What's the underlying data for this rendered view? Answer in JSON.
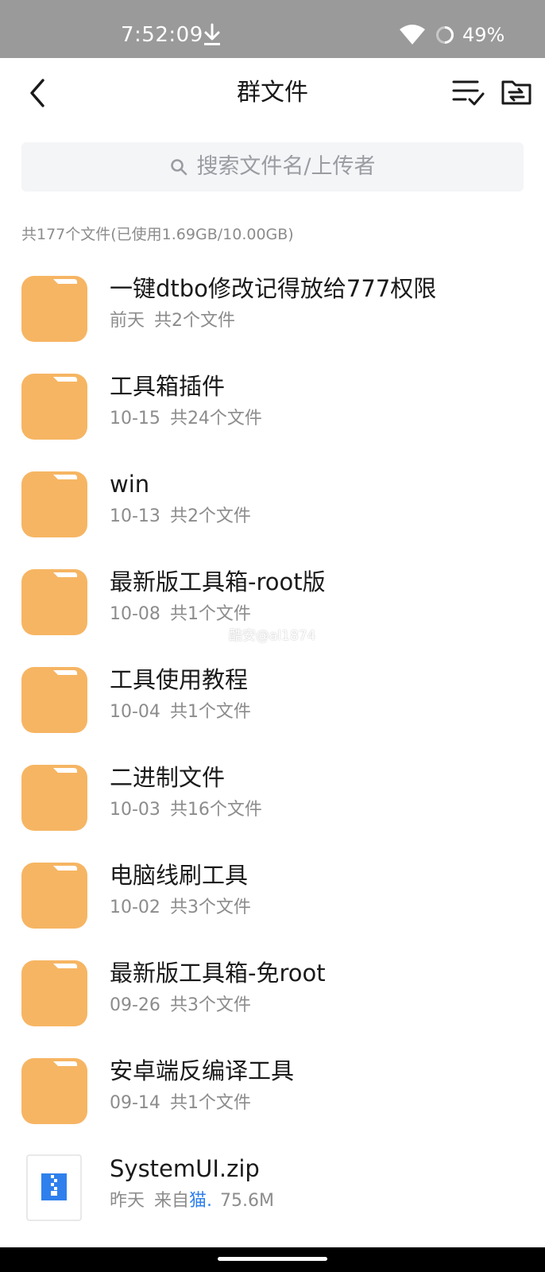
{
  "status_bar": {
    "time": "7:52:09",
    "battery_percent": "49%",
    "icons": [
      "download-icon",
      "wifi-icon",
      "battery-icon"
    ]
  },
  "header": {
    "title": "群文件",
    "back_icon": "chevron-left-icon",
    "sort_icon": "sort-list-icon",
    "folder_icon": "folder-transfer-icon"
  },
  "search": {
    "placeholder": "搜索文件名/上传者"
  },
  "storage_info": "共177个文件(已使用1.69GB/10.00GB)",
  "files": [
    {
      "type": "folder",
      "name": "一键dtbo修改记得放给777权限",
      "date": "前天",
      "count": "共2个文件"
    },
    {
      "type": "folder",
      "name": "工具箱插件",
      "date": "10-15",
      "count": "共24个文件"
    },
    {
      "type": "folder",
      "name": "win",
      "date": "10-13",
      "count": "共2个文件"
    },
    {
      "type": "folder",
      "name": "最新版工具箱-root版",
      "date": "10-08",
      "count": "共1个文件"
    },
    {
      "type": "folder",
      "name": "工具使用教程",
      "date": "10-04",
      "count": "共1个文件"
    },
    {
      "type": "folder",
      "name": "二进制文件",
      "date": "10-03",
      "count": "共16个文件"
    },
    {
      "type": "folder",
      "name": "电脑线刷工具",
      "date": "10-02",
      "count": "共3个文件"
    },
    {
      "type": "folder",
      "name": "最新版工具箱-免root",
      "date": "09-26",
      "count": "共3个文件"
    },
    {
      "type": "folder",
      "name": "安卓端反编译工具",
      "date": "09-14",
      "count": "共1个文件"
    }
  ],
  "zip_file": {
    "type": "zip",
    "name": "SystemUI.zip",
    "date": "昨天",
    "from_label": "来自",
    "uploader": "猫.",
    "size": "75.6M"
  },
  "watermark": "酷安@al1874",
  "colors": {
    "status_bar_bg": "#9a9a9a",
    "folder": "#f6b563",
    "folder_tab": "#ffffff",
    "zip_blue": "#2f80ed",
    "uploader_link": "#2f80ed",
    "secondary_text": "#8c8c8c"
  }
}
